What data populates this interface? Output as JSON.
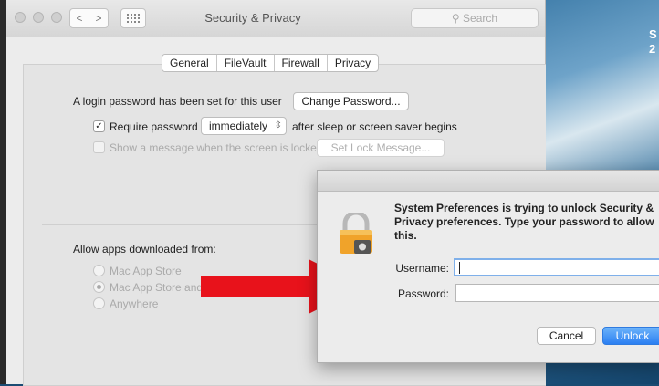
{
  "desktop": {
    "corner_text_line1": "S",
    "corner_text_line2": "2"
  },
  "window": {
    "title": "Security & Privacy",
    "search_placeholder": "Search",
    "nav_back": "<",
    "nav_forward": ">",
    "grid_icon": "grid-icon"
  },
  "tabs": [
    "General",
    "FileVault",
    "Firewall",
    "Privacy"
  ],
  "general": {
    "login_text": "A login password has been set for this user",
    "change_password": "Change Password...",
    "require_password_label": "Require password",
    "require_password_value": "immediately",
    "after_sleep_text": "after sleep or screen saver begins",
    "show_message_label": "Show a message when the screen is locked",
    "set_lock_message": "Set Lock Message...",
    "allow_apps_label": "Allow apps downloaded from:",
    "options": [
      "Mac App Store",
      "Mac App Store and identified developers",
      "Anywhere"
    ],
    "options_visible": [
      "Mac App Store",
      "Mac App Store and",
      "Anywhere"
    ],
    "selected_option_index": 1
  },
  "dialog": {
    "message": "System Preferences is trying to unlock Security & Privacy preferences. Type your password to allow this.",
    "username_label": "Username:",
    "username_value": "",
    "password_label": "Password:",
    "password_value": "",
    "cancel_label": "Cancel",
    "unlock_label": "Unlock"
  },
  "colors": {
    "arrow": "#e8121b",
    "accent": "#2b7ff2"
  }
}
